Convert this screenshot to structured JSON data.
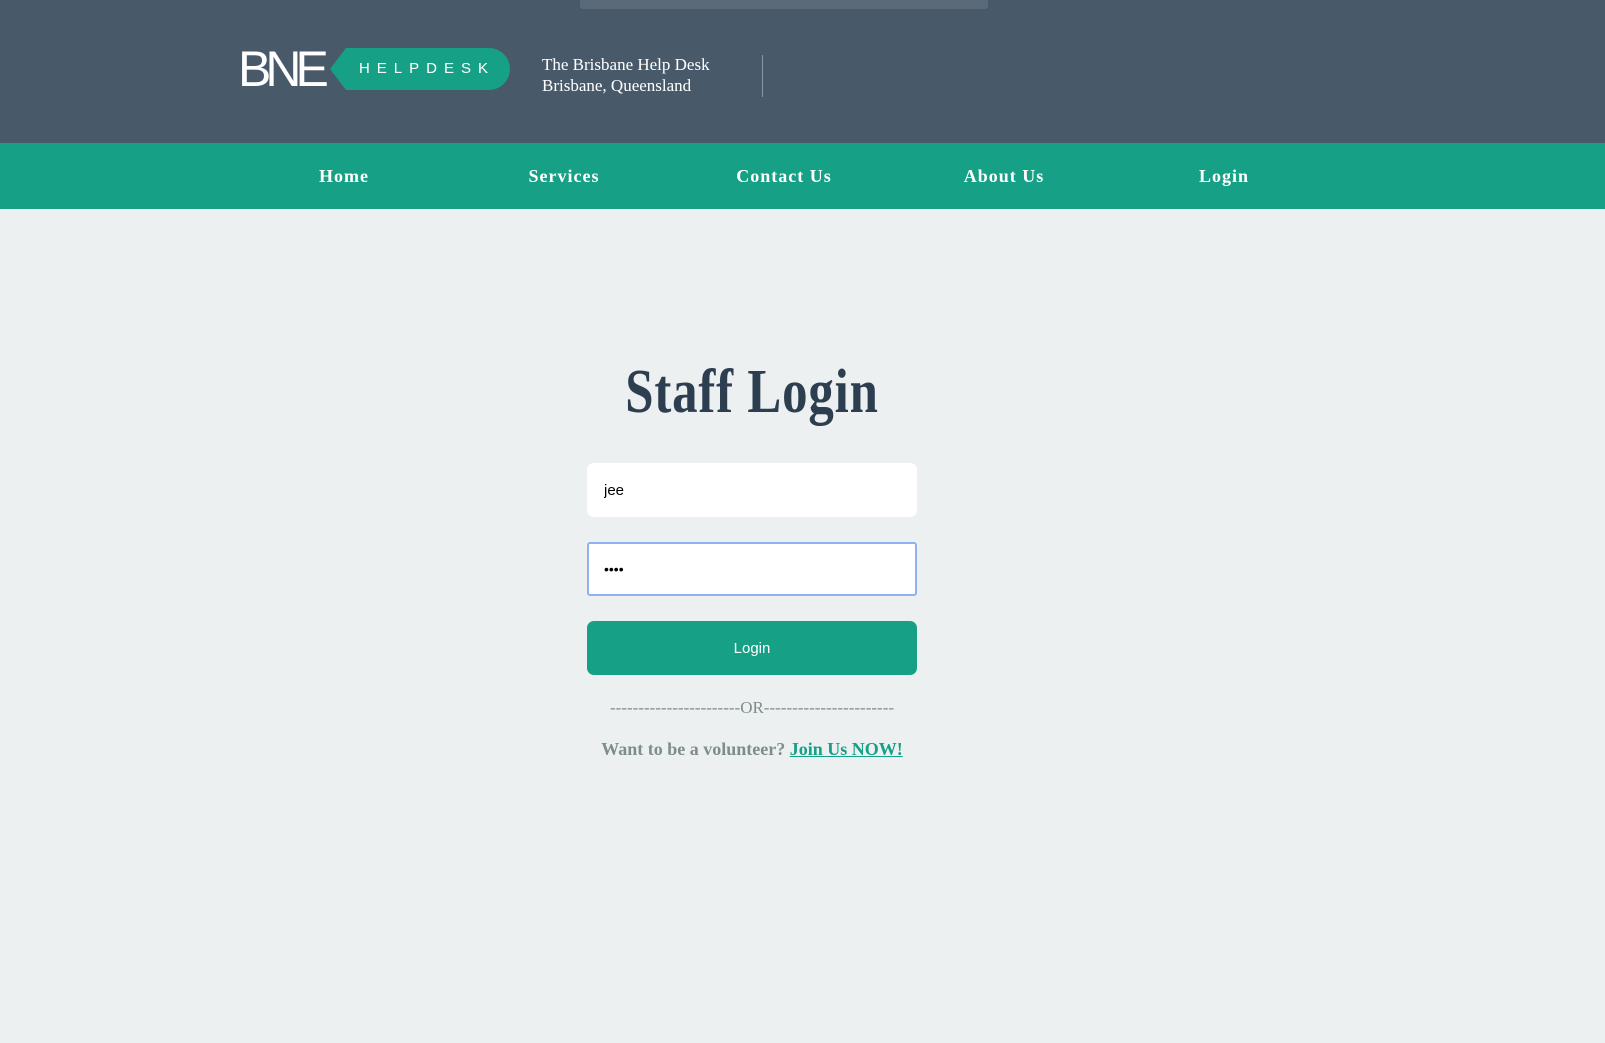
{
  "header": {
    "logo": {
      "mark": "BNE",
      "tag": "HELPDESK"
    },
    "org_name": "The Brisbane Help Desk",
    "org_location": "Brisbane, Queensland"
  },
  "nav": {
    "items": [
      {
        "label": "Home"
      },
      {
        "label": "Services"
      },
      {
        "label": "Contact Us"
      },
      {
        "label": "About Us"
      },
      {
        "label": "Login"
      }
    ]
  },
  "login_form": {
    "title": "Staff Login",
    "username_value": "jee",
    "password_value": "abcd",
    "submit_label": "Login",
    "or_divider": "-----------------------OR-----------------------",
    "volunteer_prompt": "Want to be a volunteer?",
    "join_link": "Join Us NOW!"
  },
  "colors": {
    "header_bg": "#485a6a",
    "accent": "#16a085",
    "page_bg": "#ecf0f1",
    "title": "#2c3e50",
    "muted_text": "#7f8c8d",
    "focus_border": "#8fb1ef"
  }
}
